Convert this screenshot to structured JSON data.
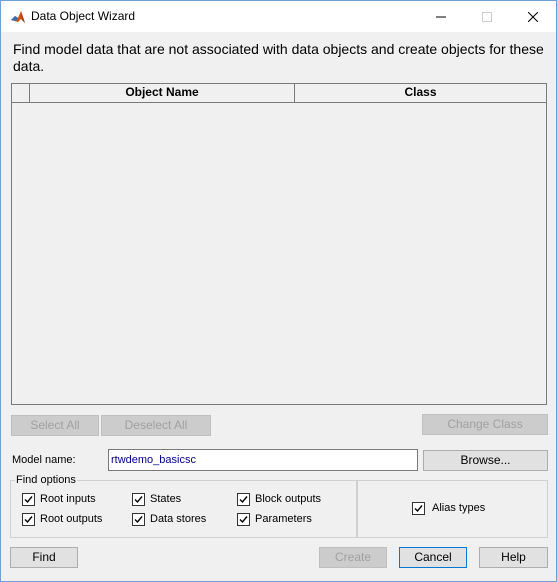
{
  "window": {
    "title": "Data Object Wizard"
  },
  "description": "Find model data that are not associated with data objects and create objects for these data.",
  "table": {
    "columns": [
      "",
      "Object Name",
      "Class"
    ],
    "rows": []
  },
  "selection_buttons": {
    "select_all": "Select All",
    "deselect_all": "Deselect All",
    "change_class": "Change Class"
  },
  "model": {
    "label": "Model name:",
    "value": "rtwdemo_basicsc",
    "browse_label": "Browse..."
  },
  "find_options": {
    "legend": "Find options",
    "options": [
      {
        "label": "Root inputs",
        "checked": true
      },
      {
        "label": "States",
        "checked": true
      },
      {
        "label": "Block outputs",
        "checked": true
      },
      {
        "label": "Root outputs",
        "checked": true
      },
      {
        "label": "Data stores",
        "checked": true
      },
      {
        "label": "Parameters",
        "checked": true
      }
    ],
    "alias_types": {
      "label": "Alias types",
      "checked": true
    }
  },
  "footer": {
    "find": "Find",
    "create": "Create",
    "cancel": "Cancel",
    "help": "Help"
  },
  "icons": {
    "app": "matlab-icon",
    "minimize": "minimize-icon",
    "maximize": "maximize-icon",
    "close": "close-icon"
  },
  "colors": {
    "window_bg": "#f0f0f0",
    "title_bg": "#ffffff",
    "model_value_text": "#00008b",
    "default_button_border": "#0078d7"
  }
}
